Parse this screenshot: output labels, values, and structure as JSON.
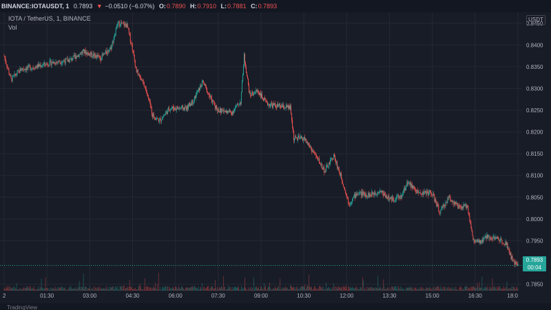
{
  "header": {
    "symbol": "BINANCE:IOTAUSDT, 1",
    "price": "0.7893",
    "arrow": "▼",
    "change": "−0.0510 (−6.07%)",
    "o_label": "O:",
    "o_value": "0.7890",
    "h_label": "H:",
    "h_value": "0.7910",
    "l_label": "L:",
    "l_value": "0.7881",
    "c_label": "C:",
    "c_value": "0.7893"
  },
  "legend": {
    "title": "IOTA / TetherUS, 1, BINANCE",
    "volume": "Vol"
  },
  "axis": {
    "unit": "USDT"
  },
  "price_tag": {
    "price": "0.7893",
    "countdown": "00:04"
  },
  "footer": {
    "brand": "TradingView"
  },
  "colors": {
    "up": "#26a69a",
    "down": "#ef5350",
    "background": "#181c27",
    "grid": "#242832",
    "text": "#b2b5be"
  },
  "chart_data": {
    "type": "candlestick",
    "y_ticks": [
      "0.8450",
      "0.8400",
      "0.8350",
      "0.8300",
      "0.8250",
      "0.8200",
      "0.8150",
      "0.8100",
      "0.8050",
      "0.8000",
      "0.7950",
      "0.7850"
    ],
    "x_ticks": [
      "2",
      "01:30",
      "03:00",
      "04:30",
      "06:00",
      "07:30",
      "09:00",
      "10:30",
      "12:00",
      "13:30",
      "15:00",
      "16:30",
      "18:0"
    ],
    "ylim": [
      0.7835,
      0.8475
    ],
    "last_price": 0.7893,
    "close_series": [
      {
        "t": 0,
        "c": 0.8375
      },
      {
        "t": 10,
        "c": 0.832
      },
      {
        "t": 25,
        "c": 0.8345
      },
      {
        "t": 45,
        "c": 0.835
      },
      {
        "t": 70,
        "c": 0.836
      },
      {
        "t": 95,
        "c": 0.8365
      },
      {
        "t": 115,
        "c": 0.8385
      },
      {
        "t": 140,
        "c": 0.837
      },
      {
        "t": 155,
        "c": 0.8395
      },
      {
        "t": 165,
        "c": 0.845
      },
      {
        "t": 178,
        "c": 0.8445
      },
      {
        "t": 185,
        "c": 0.84
      },
      {
        "t": 192,
        "c": 0.834
      },
      {
        "t": 205,
        "c": 0.83
      },
      {
        "t": 215,
        "c": 0.824
      },
      {
        "t": 225,
        "c": 0.8225
      },
      {
        "t": 240,
        "c": 0.8255
      },
      {
        "t": 265,
        "c": 0.8255
      },
      {
        "t": 275,
        "c": 0.8275
      },
      {
        "t": 288,
        "c": 0.8315
      },
      {
        "t": 300,
        "c": 0.8275
      },
      {
        "t": 310,
        "c": 0.825
      },
      {
        "t": 330,
        "c": 0.8245
      },
      {
        "t": 343,
        "c": 0.827
      },
      {
        "t": 348,
        "c": 0.8375
      },
      {
        "t": 356,
        "c": 0.8285
      },
      {
        "t": 368,
        "c": 0.8295
      },
      {
        "t": 380,
        "c": 0.8265
      },
      {
        "t": 395,
        "c": 0.826
      },
      {
        "t": 415,
        "c": 0.8255
      },
      {
        "t": 420,
        "c": 0.8185
      },
      {
        "t": 435,
        "c": 0.8185
      },
      {
        "t": 450,
        "c": 0.815
      },
      {
        "t": 465,
        "c": 0.811
      },
      {
        "t": 478,
        "c": 0.8145
      },
      {
        "t": 490,
        "c": 0.809
      },
      {
        "t": 500,
        "c": 0.8035
      },
      {
        "t": 512,
        "c": 0.806
      },
      {
        "t": 530,
        "c": 0.8055
      },
      {
        "t": 545,
        "c": 0.8065
      },
      {
        "t": 560,
        "c": 0.8045
      },
      {
        "t": 575,
        "c": 0.805
      },
      {
        "t": 585,
        "c": 0.8085
      },
      {
        "t": 600,
        "c": 0.806
      },
      {
        "t": 620,
        "c": 0.806
      },
      {
        "t": 632,
        "c": 0.8015
      },
      {
        "t": 645,
        "c": 0.805
      },
      {
        "t": 660,
        "c": 0.8025
      },
      {
        "t": 672,
        "c": 0.803
      },
      {
        "t": 680,
        "c": 0.795
      },
      {
        "t": 690,
        "c": 0.7945
      },
      {
        "t": 700,
        "c": 0.796
      },
      {
        "t": 715,
        "c": 0.7955
      },
      {
        "t": 728,
        "c": 0.7945
      },
      {
        "t": 738,
        "c": 0.79
      },
      {
        "t": 745,
        "c": 0.7893
      }
    ]
  }
}
